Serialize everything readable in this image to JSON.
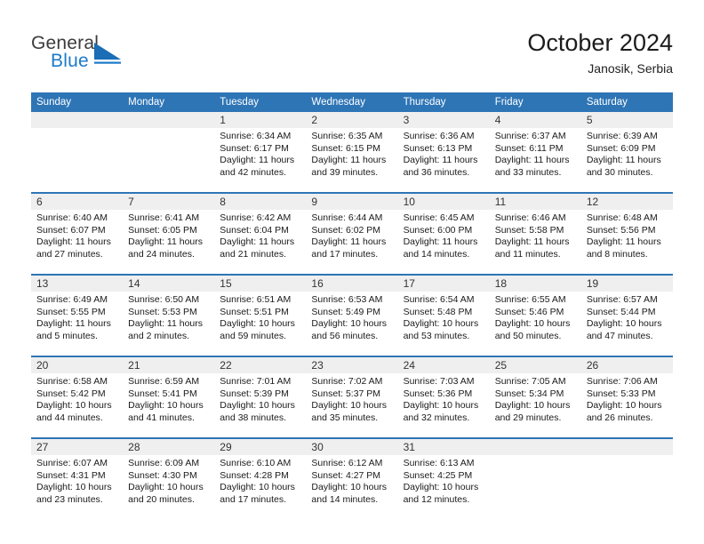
{
  "brand": {
    "name_part1": "General",
    "name_part2": "Blue",
    "mark_icon": "blue-triangle-logo-icon",
    "accent_color": "#1b7ac9"
  },
  "header": {
    "title": "October 2024",
    "subtitle": "Janosik, Serbia"
  },
  "theme": {
    "header_bar_color": "#2e75b6",
    "daynum_band_color": "#efefef",
    "row_separator_color": "#2e75b6",
    "cell_background": "#ffffff"
  },
  "weekday_headers": [
    "Sunday",
    "Monday",
    "Tuesday",
    "Wednesday",
    "Thursday",
    "Friday",
    "Saturday"
  ],
  "labels": {
    "sunrise_prefix": "Sunrise:",
    "sunset_prefix": "Sunset:",
    "daylight_prefix": "Daylight:"
  },
  "weeks": [
    [
      {
        "day": "",
        "empty": true,
        "sunrise": "",
        "sunset": "",
        "daylight_line1": "",
        "daylight_line2": ""
      },
      {
        "day": "",
        "empty": true,
        "sunrise": "",
        "sunset": "",
        "daylight_line1": "",
        "daylight_line2": ""
      },
      {
        "day": "1",
        "empty": false,
        "sunrise": "Sunrise: 6:34 AM",
        "sunset": "Sunset: 6:17 PM",
        "daylight_line1": "Daylight: 11 hours",
        "daylight_line2": "and 42 minutes."
      },
      {
        "day": "2",
        "empty": false,
        "sunrise": "Sunrise: 6:35 AM",
        "sunset": "Sunset: 6:15 PM",
        "daylight_line1": "Daylight: 11 hours",
        "daylight_line2": "and 39 minutes."
      },
      {
        "day": "3",
        "empty": false,
        "sunrise": "Sunrise: 6:36 AM",
        "sunset": "Sunset: 6:13 PM",
        "daylight_line1": "Daylight: 11 hours",
        "daylight_line2": "and 36 minutes."
      },
      {
        "day": "4",
        "empty": false,
        "sunrise": "Sunrise: 6:37 AM",
        "sunset": "Sunset: 6:11 PM",
        "daylight_line1": "Daylight: 11 hours",
        "daylight_line2": "and 33 minutes."
      },
      {
        "day": "5",
        "empty": false,
        "sunrise": "Sunrise: 6:39 AM",
        "sunset": "Sunset: 6:09 PM",
        "daylight_line1": "Daylight: 11 hours",
        "daylight_line2": "and 30 minutes."
      }
    ],
    [
      {
        "day": "6",
        "empty": false,
        "sunrise": "Sunrise: 6:40 AM",
        "sunset": "Sunset: 6:07 PM",
        "daylight_line1": "Daylight: 11 hours",
        "daylight_line2": "and 27 minutes."
      },
      {
        "day": "7",
        "empty": false,
        "sunrise": "Sunrise: 6:41 AM",
        "sunset": "Sunset: 6:05 PM",
        "daylight_line1": "Daylight: 11 hours",
        "daylight_line2": "and 24 minutes."
      },
      {
        "day": "8",
        "empty": false,
        "sunrise": "Sunrise: 6:42 AM",
        "sunset": "Sunset: 6:04 PM",
        "daylight_line1": "Daylight: 11 hours",
        "daylight_line2": "and 21 minutes."
      },
      {
        "day": "9",
        "empty": false,
        "sunrise": "Sunrise: 6:44 AM",
        "sunset": "Sunset: 6:02 PM",
        "daylight_line1": "Daylight: 11 hours",
        "daylight_line2": "and 17 minutes."
      },
      {
        "day": "10",
        "empty": false,
        "sunrise": "Sunrise: 6:45 AM",
        "sunset": "Sunset: 6:00 PM",
        "daylight_line1": "Daylight: 11 hours",
        "daylight_line2": "and 14 minutes."
      },
      {
        "day": "11",
        "empty": false,
        "sunrise": "Sunrise: 6:46 AM",
        "sunset": "Sunset: 5:58 PM",
        "daylight_line1": "Daylight: 11 hours",
        "daylight_line2": "and 11 minutes."
      },
      {
        "day": "12",
        "empty": false,
        "sunrise": "Sunrise: 6:48 AM",
        "sunset": "Sunset: 5:56 PM",
        "daylight_line1": "Daylight: 11 hours",
        "daylight_line2": "and 8 minutes."
      }
    ],
    [
      {
        "day": "13",
        "empty": false,
        "sunrise": "Sunrise: 6:49 AM",
        "sunset": "Sunset: 5:55 PM",
        "daylight_line1": "Daylight: 11 hours",
        "daylight_line2": "and 5 minutes."
      },
      {
        "day": "14",
        "empty": false,
        "sunrise": "Sunrise: 6:50 AM",
        "sunset": "Sunset: 5:53 PM",
        "daylight_line1": "Daylight: 11 hours",
        "daylight_line2": "and 2 minutes."
      },
      {
        "day": "15",
        "empty": false,
        "sunrise": "Sunrise: 6:51 AM",
        "sunset": "Sunset: 5:51 PM",
        "daylight_line1": "Daylight: 10 hours",
        "daylight_line2": "and 59 minutes."
      },
      {
        "day": "16",
        "empty": false,
        "sunrise": "Sunrise: 6:53 AM",
        "sunset": "Sunset: 5:49 PM",
        "daylight_line1": "Daylight: 10 hours",
        "daylight_line2": "and 56 minutes."
      },
      {
        "day": "17",
        "empty": false,
        "sunrise": "Sunrise: 6:54 AM",
        "sunset": "Sunset: 5:48 PM",
        "daylight_line1": "Daylight: 10 hours",
        "daylight_line2": "and 53 minutes."
      },
      {
        "day": "18",
        "empty": false,
        "sunrise": "Sunrise: 6:55 AM",
        "sunset": "Sunset: 5:46 PM",
        "daylight_line1": "Daylight: 10 hours",
        "daylight_line2": "and 50 minutes."
      },
      {
        "day": "19",
        "empty": false,
        "sunrise": "Sunrise: 6:57 AM",
        "sunset": "Sunset: 5:44 PM",
        "daylight_line1": "Daylight: 10 hours",
        "daylight_line2": "and 47 minutes."
      }
    ],
    [
      {
        "day": "20",
        "empty": false,
        "sunrise": "Sunrise: 6:58 AM",
        "sunset": "Sunset: 5:42 PM",
        "daylight_line1": "Daylight: 10 hours",
        "daylight_line2": "and 44 minutes."
      },
      {
        "day": "21",
        "empty": false,
        "sunrise": "Sunrise: 6:59 AM",
        "sunset": "Sunset: 5:41 PM",
        "daylight_line1": "Daylight: 10 hours",
        "daylight_line2": "and 41 minutes."
      },
      {
        "day": "22",
        "empty": false,
        "sunrise": "Sunrise: 7:01 AM",
        "sunset": "Sunset: 5:39 PM",
        "daylight_line1": "Daylight: 10 hours",
        "daylight_line2": "and 38 minutes."
      },
      {
        "day": "23",
        "empty": false,
        "sunrise": "Sunrise: 7:02 AM",
        "sunset": "Sunset: 5:37 PM",
        "daylight_line1": "Daylight: 10 hours",
        "daylight_line2": "and 35 minutes."
      },
      {
        "day": "24",
        "empty": false,
        "sunrise": "Sunrise: 7:03 AM",
        "sunset": "Sunset: 5:36 PM",
        "daylight_line1": "Daylight: 10 hours",
        "daylight_line2": "and 32 minutes."
      },
      {
        "day": "25",
        "empty": false,
        "sunrise": "Sunrise: 7:05 AM",
        "sunset": "Sunset: 5:34 PM",
        "daylight_line1": "Daylight: 10 hours",
        "daylight_line2": "and 29 minutes."
      },
      {
        "day": "26",
        "empty": false,
        "sunrise": "Sunrise: 7:06 AM",
        "sunset": "Sunset: 5:33 PM",
        "daylight_line1": "Daylight: 10 hours",
        "daylight_line2": "and 26 minutes."
      }
    ],
    [
      {
        "day": "27",
        "empty": false,
        "sunrise": "Sunrise: 6:07 AM",
        "sunset": "Sunset: 4:31 PM",
        "daylight_line1": "Daylight: 10 hours",
        "daylight_line2": "and 23 minutes."
      },
      {
        "day": "28",
        "empty": false,
        "sunrise": "Sunrise: 6:09 AM",
        "sunset": "Sunset: 4:30 PM",
        "daylight_line1": "Daylight: 10 hours",
        "daylight_line2": "and 20 minutes."
      },
      {
        "day": "29",
        "empty": false,
        "sunrise": "Sunrise: 6:10 AM",
        "sunset": "Sunset: 4:28 PM",
        "daylight_line1": "Daylight: 10 hours",
        "daylight_line2": "and 17 minutes."
      },
      {
        "day": "30",
        "empty": false,
        "sunrise": "Sunrise: 6:12 AM",
        "sunset": "Sunset: 4:27 PM",
        "daylight_line1": "Daylight: 10 hours",
        "daylight_line2": "and 14 minutes."
      },
      {
        "day": "31",
        "empty": false,
        "sunrise": "Sunrise: 6:13 AM",
        "sunset": "Sunset: 4:25 PM",
        "daylight_line1": "Daylight: 10 hours",
        "daylight_line2": "and 12 minutes."
      },
      {
        "day": "",
        "empty": true,
        "sunrise": "",
        "sunset": "",
        "daylight_line1": "",
        "daylight_line2": ""
      },
      {
        "day": "",
        "empty": true,
        "sunrise": "",
        "sunset": "",
        "daylight_line1": "",
        "daylight_line2": ""
      }
    ]
  ]
}
